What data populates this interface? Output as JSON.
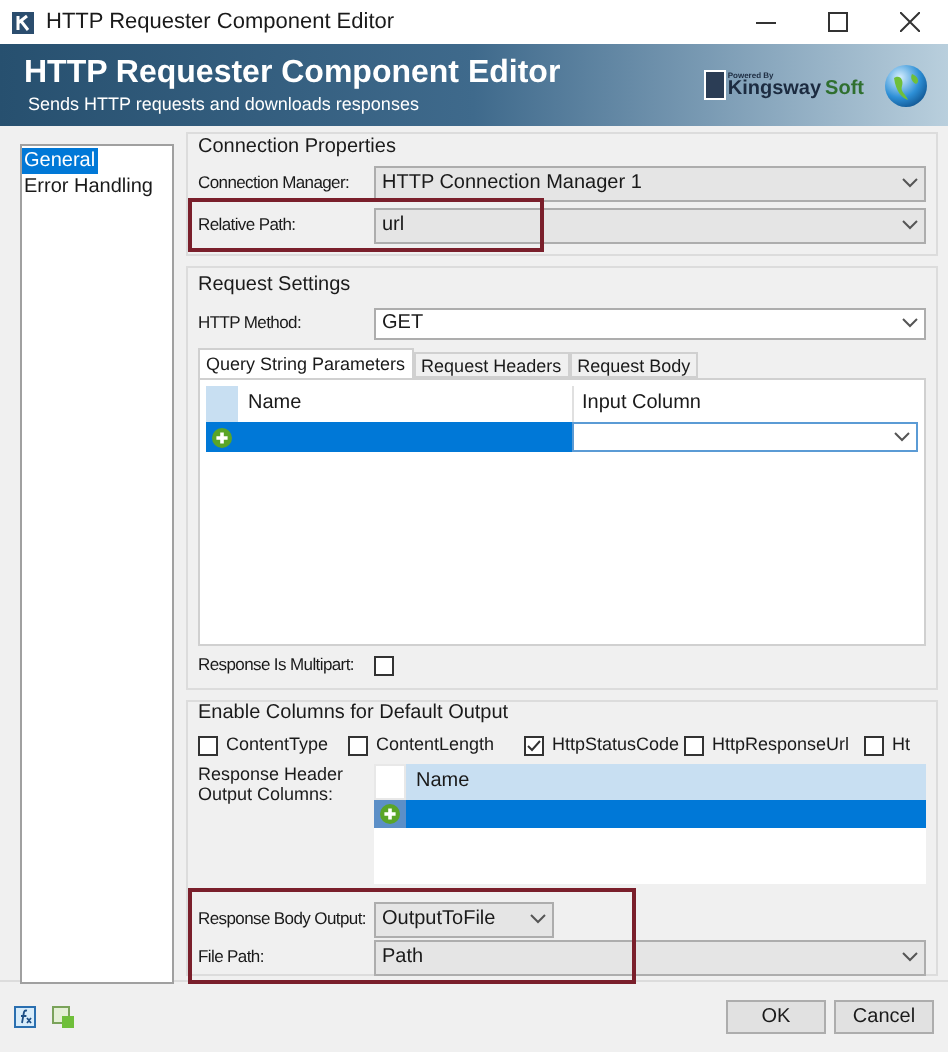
{
  "window": {
    "title": "HTTP Requester Component Editor"
  },
  "banner": {
    "title": "HTTP Requester Component Editor",
    "subtitle": "Sends HTTP requests and downloads responses",
    "logo": {
      "powered": "Powered By",
      "brand": "Kingsway",
      "suffix": "Soft"
    }
  },
  "nav": [
    {
      "label": "General",
      "selected": true
    },
    {
      "label": "Error Handling",
      "selected": false
    }
  ],
  "connection_properties": {
    "title": "Connection Properties",
    "fields": [
      {
        "label": "Connection Manager:",
        "value": "HTTP Connection Manager 1"
      },
      {
        "label": "Relative Path:",
        "value": "url",
        "highlighted": true
      }
    ]
  },
  "request_settings": {
    "title": "Request Settings",
    "method": {
      "label": "HTTP Method:",
      "value": "GET"
    },
    "tabs": [
      {
        "label": "Query String Parameters",
        "selected": true
      },
      {
        "label": "Request Headers",
        "selected": false
      },
      {
        "label": "Request Body",
        "selected": false
      }
    ],
    "grid": {
      "columns": [
        "Name",
        "Input Column"
      ]
    },
    "multipart": {
      "label": "Response Is Multipart:",
      "checked": false
    }
  },
  "default_output": {
    "title": "Enable Columns for Default Output",
    "columns": [
      {
        "label": "ContentType",
        "checked": false
      },
      {
        "label": "ContentLength",
        "checked": false
      },
      {
        "label": "HttpStatusCode",
        "checked": true
      },
      {
        "label": "HttpResponseUrl",
        "checked": false
      },
      {
        "label": "Ht",
        "checked": false
      }
    ],
    "header_columns": {
      "label": "Response Header Output Columns:",
      "columns": [
        "Name"
      ]
    }
  },
  "response_body": {
    "highlighted": true,
    "output": {
      "label": "Response Body Output:",
      "value": "OutputToFile"
    },
    "file_path": {
      "label": "File Path:",
      "value": "Path"
    }
  },
  "buttons": [
    "OK",
    "Cancel"
  ]
}
